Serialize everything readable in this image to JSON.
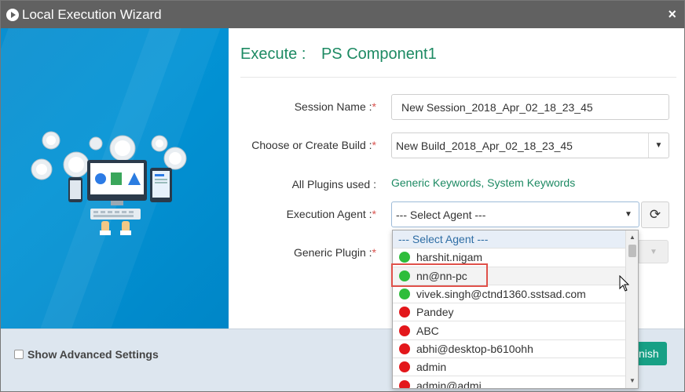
{
  "window": {
    "title": "Local Execution Wizard",
    "close_symbol": "×"
  },
  "heading": {
    "prefix": "Execute :",
    "component": "PS Component1"
  },
  "form": {
    "session_name_label": "Session Name :",
    "session_name_value": "New Session_2018_Apr_02_18_23_45",
    "build_label": "Choose or Create Build :",
    "build_value": "New Build_2018_Apr_02_18_23_45",
    "plugins_label": "All Plugins used :",
    "plugins_value": "Generic Keywords, System Keywords",
    "agent_label": "Execution Agent :",
    "agent_value": "--- Select Agent ---",
    "generic_plugin_label": "Generic Plugin :",
    "required_mark": "*"
  },
  "agent_dropdown": {
    "header": "--- Select Agent ---",
    "items": [
      {
        "label": "harshit.nigam",
        "status": "online"
      },
      {
        "label": "nn@nn-pc",
        "status": "online"
      },
      {
        "label": "vivek.singh@ctnd1360.sstsad.com",
        "status": "online"
      },
      {
        "label": "Pandey",
        "status": "offline"
      },
      {
        "label": "ABC",
        "status": "offline"
      },
      {
        "label": "abhi@desktop-b610ohh",
        "status": "offline"
      },
      {
        "label": "admin",
        "status": "offline"
      },
      {
        "label": "admin@admi",
        "status": "offline"
      }
    ]
  },
  "footer": {
    "advanced_label": "Show Advanced Settings",
    "finish_label": "Finish"
  },
  "colors": {
    "accent_green": "#1d8a63",
    "online": "#2ebd3b",
    "offline": "#e3171b",
    "highlight": "#e0514a",
    "finish_button": "#17a085"
  },
  "icons": {
    "title": "play-circle-icon",
    "refresh": "refresh-icon",
    "caret": "caret-down-icon"
  }
}
